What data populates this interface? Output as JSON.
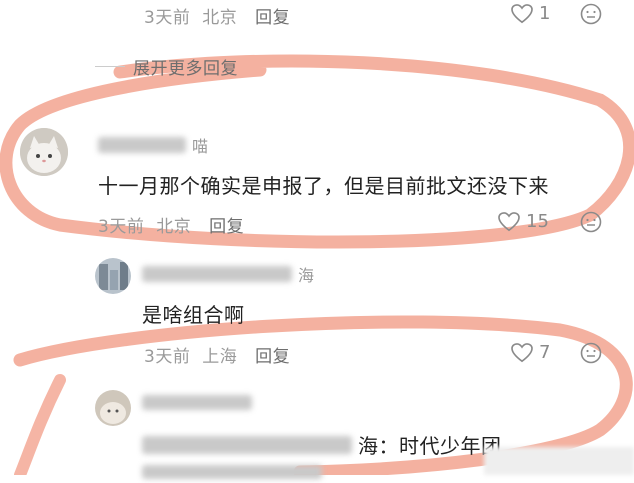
{
  "comments": [
    {
      "meta": {
        "time": "3天前",
        "location": "北京",
        "reply": "回复"
      },
      "likes": "1"
    },
    {
      "expand": "展开更多回复"
    },
    {
      "username_visible": "喵",
      "text": "十一月那个确实是申报了，但是目前批文还没下来",
      "meta": {
        "time": "3天前",
        "location": "北京",
        "reply": "回复"
      },
      "likes": "15"
    },
    {
      "username_visible": "海",
      "text": "是啥组合啊",
      "meta": {
        "time": "3天前",
        "location": "上海",
        "reply": "回复"
      },
      "likes": "7"
    },
    {
      "text_visible": "海：时代少年团"
    }
  ],
  "annotation_color": "#f2a38f",
  "icons": [
    "heart-icon",
    "emoji-icon"
  ]
}
